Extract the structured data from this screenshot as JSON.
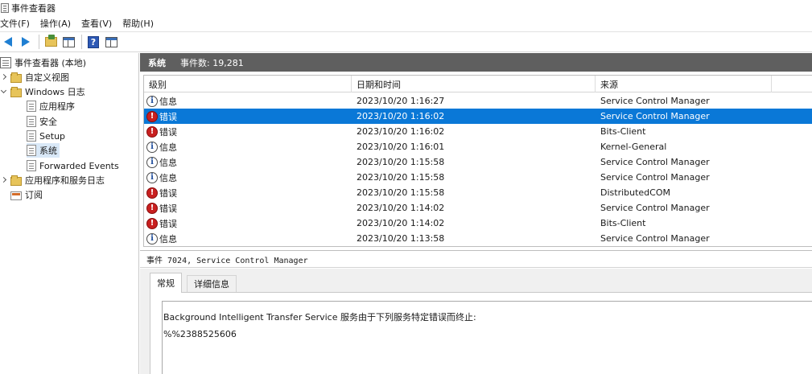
{
  "window": {
    "title": "事件查看器"
  },
  "menu": {
    "items": [
      "文件(F)",
      "操作(A)",
      "查看(V)",
      "帮助(H)"
    ]
  },
  "toolbar": {
    "icons": [
      "back-arrow-icon",
      "forward-arrow-icon",
      "folder-icon",
      "console-pane-icon",
      "help-icon",
      "properties-pane-icon"
    ]
  },
  "nav": {
    "root": "事件查看器 (本地)",
    "custom_views": "自定义视图",
    "windows_logs": "Windows 日志",
    "logs": [
      "应用程序",
      "安全",
      "Setup",
      "系统",
      "Forwarded Events"
    ],
    "app_service_logs": "应用程序和服务日志",
    "subscriptions": "订阅"
  },
  "header": {
    "title": "系统",
    "count_label": "事件数: 19,281"
  },
  "table": {
    "columns": [
      "级别",
      "日期和时间",
      "来源"
    ],
    "rows": [
      {
        "level": "信息",
        "type": "info",
        "datetime": "2023/10/20 1:16:27",
        "source": "Service Control Manager"
      },
      {
        "level": "错误",
        "type": "error",
        "datetime": "2023/10/20 1:16:02",
        "source": "Service Control Manager",
        "selected": true
      },
      {
        "level": "错误",
        "type": "error",
        "datetime": "2023/10/20 1:16:02",
        "source": "Bits-Client"
      },
      {
        "level": "信息",
        "type": "info",
        "datetime": "2023/10/20 1:16:01",
        "source": "Kernel-General"
      },
      {
        "level": "信息",
        "type": "info",
        "datetime": "2023/10/20 1:15:58",
        "source": "Service Control Manager"
      },
      {
        "level": "信息",
        "type": "info",
        "datetime": "2023/10/20 1:15:58",
        "source": "Service Control Manager"
      },
      {
        "level": "错误",
        "type": "error",
        "datetime": "2023/10/20 1:15:58",
        "source": "DistributedCOM"
      },
      {
        "level": "错误",
        "type": "error",
        "datetime": "2023/10/20 1:14:02",
        "source": "Service Control Manager"
      },
      {
        "level": "错误",
        "type": "error",
        "datetime": "2023/10/20 1:14:02",
        "source": "Bits-Client"
      },
      {
        "level": "信息",
        "type": "info",
        "datetime": "2023/10/20 1:13:58",
        "source": "Service Control Manager"
      }
    ]
  },
  "detail": {
    "header": "事件 7024, Service Control Manager",
    "tabs": [
      "常规",
      "详细信息"
    ],
    "description_line1": "Background Intelligent Transfer Service 服务由于下列服务特定错误而终止:",
    "description_line2": "%%2388525606"
  },
  "colors": {
    "selection": "#0a78d7",
    "header_bar": "#5f5f5f",
    "error": "#c81f1f",
    "accent": "#1f7fd2"
  }
}
